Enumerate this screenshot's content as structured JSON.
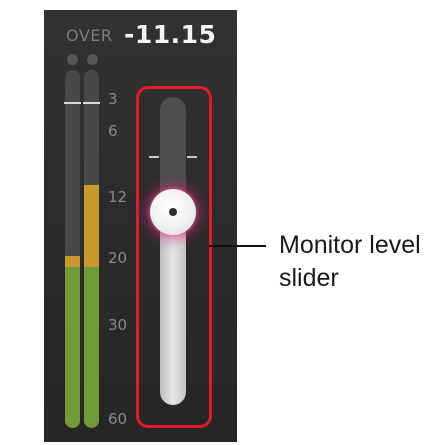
{
  "channel": {
    "over_label": "OVER",
    "level_value": "-11.15"
  },
  "meter": {
    "scale_labels": [
      "3",
      "6",
      "12",
      "20",
      "30",
      "60"
    ],
    "left_level_fraction": 0.48,
    "right_level_fraction": 0.68,
    "green_fraction": 0.45,
    "colors": {
      "green": "#6f9c37",
      "amber": "#c89a2c",
      "track": "#484848"
    }
  },
  "fader": {
    "level_fraction": 0.65,
    "highlight_color": "#e11d2a"
  },
  "callout": {
    "text": "Monitor level\nslider"
  }
}
